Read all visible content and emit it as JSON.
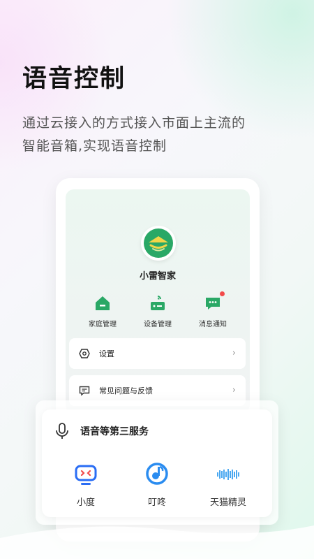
{
  "hero": {
    "title": "语音控制",
    "subtitle_line1": "通过云接入的方式接入市面上主流的",
    "subtitle_line2": "智能音箱,实现语音控制"
  },
  "app": {
    "name": "小雷智家",
    "quick_actions": [
      {
        "label": "家庭管理",
        "icon": "home-icon"
      },
      {
        "label": "设备管理",
        "icon": "device-icon"
      },
      {
        "label": "消息通知",
        "icon": "message-icon"
      }
    ],
    "menu": [
      {
        "label": "设置",
        "icon": "gear-icon"
      },
      {
        "label": "常见问题与反馈",
        "icon": "feedback-icon"
      }
    ]
  },
  "services": {
    "title": "语音等第三服务",
    "items": [
      {
        "label": "小度",
        "icon": "xiaodu-icon"
      },
      {
        "label": "叮咚",
        "icon": "dingdong-icon"
      },
      {
        "label": "天猫精灵",
        "icon": "tmall-genie-icon"
      }
    ]
  },
  "colors": {
    "accent_green": "#2aa866",
    "logo_yellow": "#f2d548",
    "badge_red": "#f24a4a",
    "xiaodu_blue": "#2a6df4",
    "xiaodu_red": "#f24a4a",
    "dingdong_blue": "#2a8cf0",
    "tmall_blue": "#4aa8f0"
  }
}
